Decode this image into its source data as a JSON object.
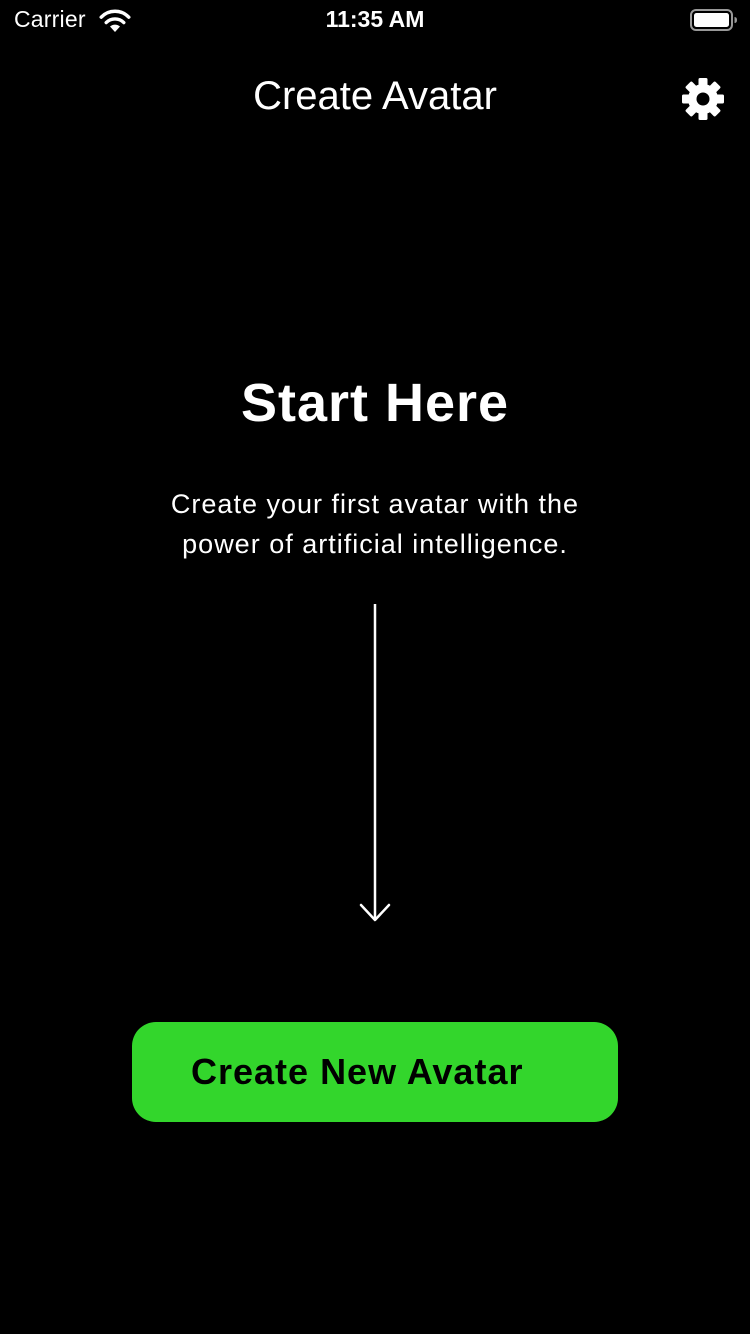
{
  "status_bar": {
    "carrier": "Carrier",
    "time": "11:35 AM"
  },
  "nav": {
    "title": "Create Avatar",
    "settings_icon": "gear-icon"
  },
  "main": {
    "headline": "Start Here",
    "description_line1": "Create your first avatar with the",
    "description_line2": "power of artificial intelligence.",
    "arrow_icon": "arrow-down-icon"
  },
  "cta": {
    "label": "Create New Avatar"
  },
  "colors": {
    "background": "#000000",
    "text": "#ffffff",
    "accent": "#33d62c"
  }
}
